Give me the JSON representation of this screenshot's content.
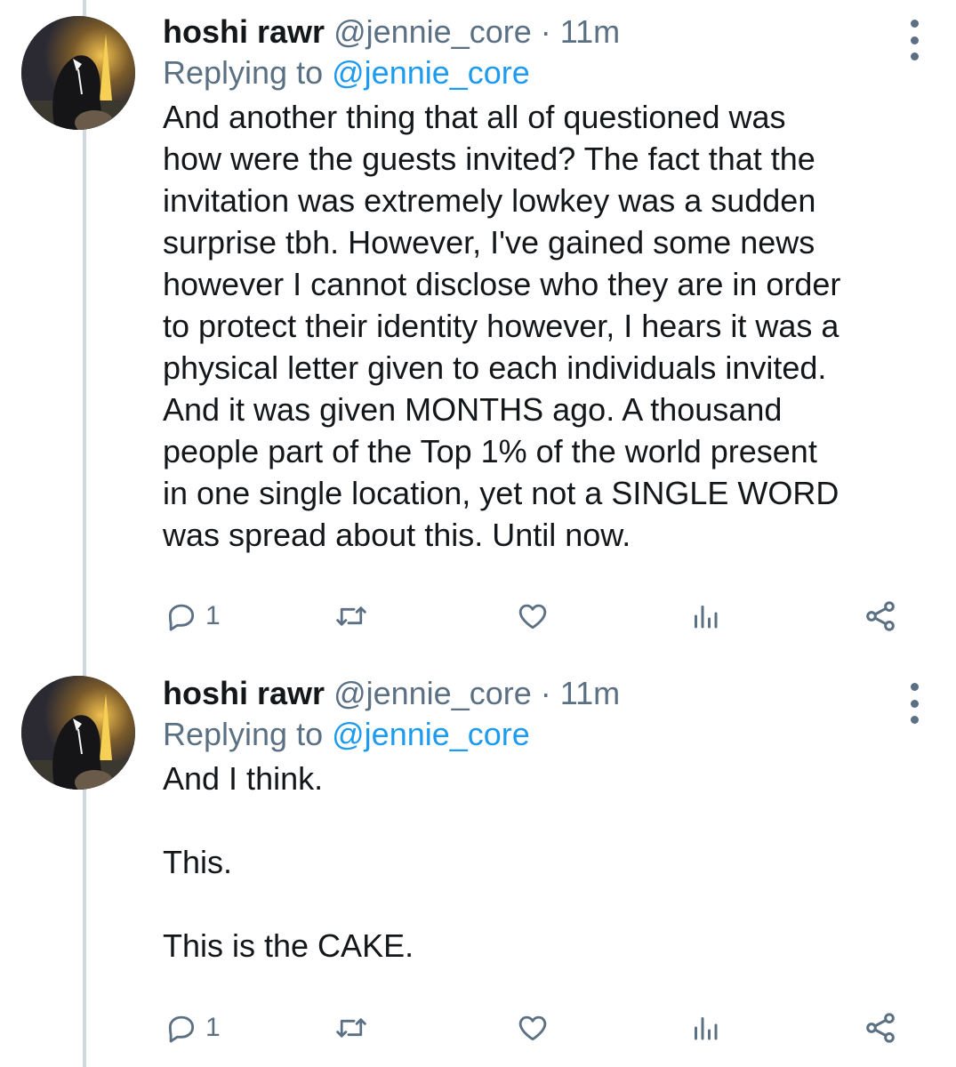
{
  "colors": {
    "link": "#1d9bf0",
    "muted": "#5b7083",
    "text": "#14171a",
    "thread_line": "#cfd9de"
  },
  "tweets": [
    {
      "display_name": "hoshi rawr",
      "handle": "@jennie_core",
      "separator": "·",
      "time": "11m",
      "replying_prefix": "Replying to",
      "replying_handle": "@jennie_core",
      "paragraphs": [
        "And another thing that all of questioned was\nhow were the guests invited? The fact that the\ninvitation was extremely lowkey was a sudden\nsurprise tbh. However, I've gained some news\nhowever I cannot disclose who they are in order\nto protect their identity however, I hears it was a\nphysical letter given to each individuals invited.\nAnd it was given MONTHS ago. A thousand\npeople part of the Top 1% of the world present\nin one single location, yet not a SINGLE WORD\nwas spread about this. Until now."
      ],
      "reply_count": "1",
      "icons": [
        "reply-icon",
        "retweet-icon",
        "like-icon",
        "views-icon",
        "share-icon"
      ]
    },
    {
      "display_name": "hoshi rawr",
      "handle": "@jennie_core",
      "separator": "·",
      "time": "11m",
      "replying_prefix": "Replying to",
      "replying_handle": "@jennie_core",
      "paragraphs": [
        "And I think.",
        "This.",
        "This is the CAKE."
      ],
      "reply_count": "1",
      "icons": [
        "reply-icon",
        "retweet-icon",
        "like-icon",
        "views-icon",
        "share-icon"
      ]
    }
  ]
}
